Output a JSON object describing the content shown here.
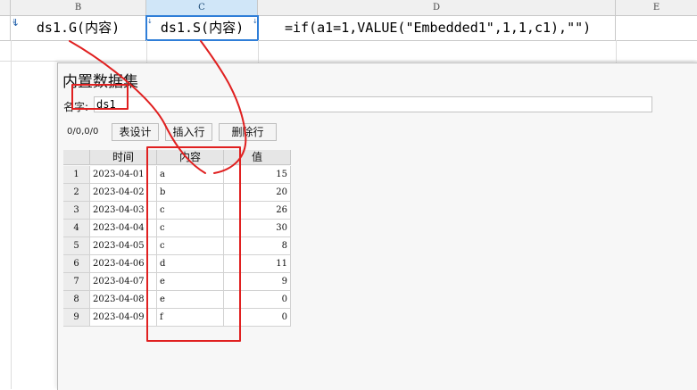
{
  "sheet": {
    "columns": [
      "",
      "B",
      "C",
      "D",
      "E"
    ],
    "cells": {
      "b": "ds1.G(内容)",
      "c": "ds1.S(内容)",
      "d": "=if(a1=1,VALUE(\"Embedded1\",1,1,c1),\"\")"
    }
  },
  "dialog": {
    "title": "内置数据集",
    "name_label": "名字:",
    "name_value": "ds1",
    "position": "0/0,0/0",
    "buttons": [
      "表设计",
      "插入行",
      "删除行"
    ],
    "table": {
      "headers": [
        "",
        "时间",
        "内容",
        "值"
      ],
      "rows": [
        [
          "1",
          "2023-04-01",
          "a",
          "15"
        ],
        [
          "2",
          "2023-04-02",
          "b",
          "20"
        ],
        [
          "3",
          "2023-04-03",
          "c",
          "26"
        ],
        [
          "4",
          "2023-04-04",
          "c",
          "30"
        ],
        [
          "5",
          "2023-04-05",
          "c",
          "8"
        ],
        [
          "6",
          "2023-04-06",
          "d",
          "11"
        ],
        [
          "7",
          "2023-04-07",
          "e",
          "9"
        ],
        [
          "8",
          "2023-04-08",
          "e",
          "0"
        ],
        [
          "9",
          "2023-04-09",
          "f",
          "0"
        ]
      ]
    }
  },
  "colors": {
    "annotation": "#e02020",
    "selection": "#2f7ed8",
    "header_selected": "#d0e6f8"
  }
}
